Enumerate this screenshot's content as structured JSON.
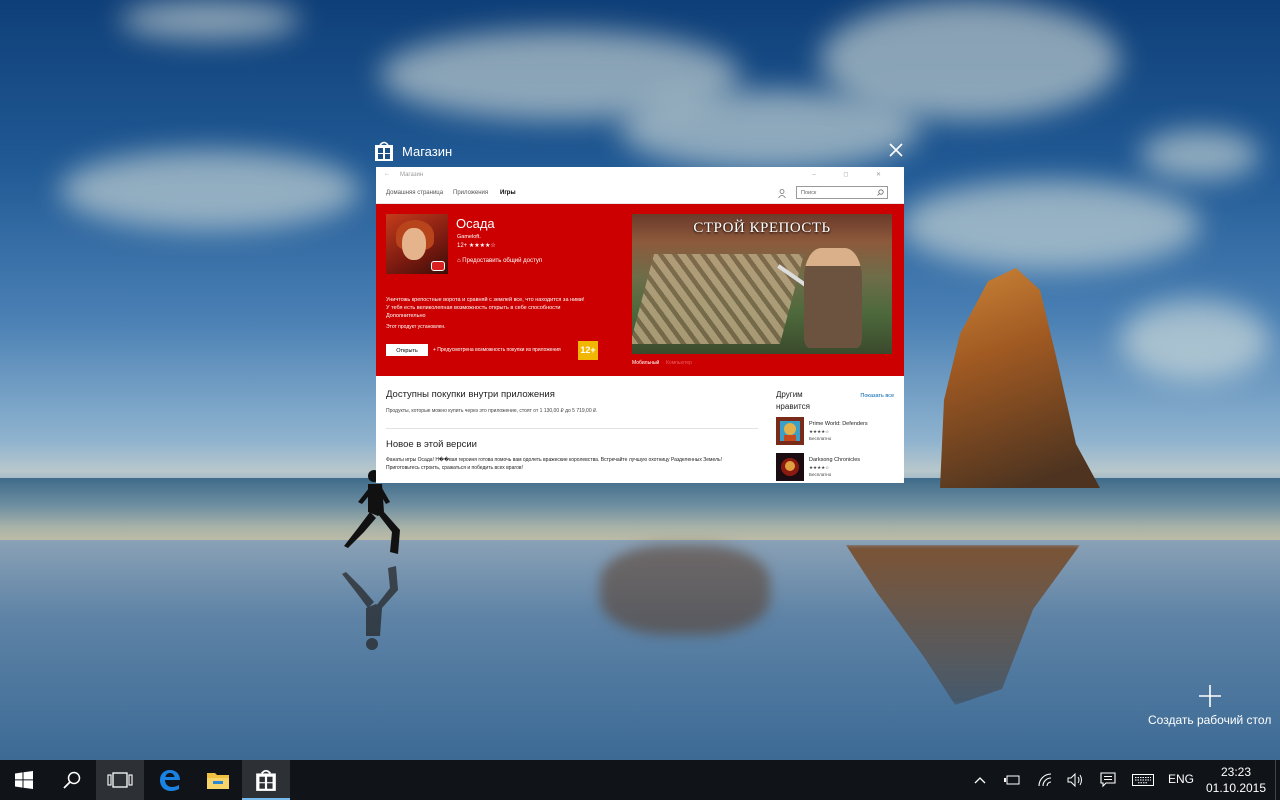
{
  "window": {
    "title": "Магазин"
  },
  "store": {
    "app_name": "Магазин",
    "titlebar_controls": "– ◻ ✕",
    "back_glyph": "←",
    "nav": {
      "home": "Домашняя страница",
      "apps": "Приложения",
      "games": "Игры",
      "search_placeholder": "Поиск"
    },
    "product": {
      "title": "Осада",
      "developer": "Gameloft.",
      "age": "12+",
      "rating_stars": "★★★★☆",
      "share": "Предоставить общий доступ",
      "description_lines": [
        "Уничтожь крепостные ворота и сравняй с землей все, что находится за ними!",
        "У тебя есть великолепная возможность открыть в себе способности",
        "Дополнительно"
      ],
      "installed": "Этот продукт установлен.",
      "open_button": "Открыть",
      "iap_note": "+ Предусмотрена возможность покупки из приложения",
      "pegi": "12+",
      "banner_text": "СТРОЙ КРЕПОСТЬ",
      "screenshot_tabs": [
        "Мобильный",
        "Компьютер"
      ]
    },
    "in_app": {
      "heading": "Доступны покупки внутри приложения",
      "text": "Продукты, которые можно купить через это приложение, стоят от 1 130,00 ₽ до 5 719,00 ₽."
    },
    "whats_new": {
      "heading": "Новое в этой версии",
      "lines": [
        "Фанаты игры Осада! Н��вая героиня готова помочь вам одолеть вражеские королевства. Встречайте лучшую охотницу Разделенных Земель!",
        "Приготовьтесь строить, сражаться и победить всех врагов!"
      ]
    },
    "sidebar": {
      "heading": "Другим нравится",
      "show_all": "Показать все",
      "items": [
        {
          "name": "Prime World: Defenders",
          "stars": "★★★★☆",
          "price": "Бесплатно"
        },
        {
          "name": "Darksong Chronicles",
          "stars": "★★★★☆",
          "price": "Бесплатно"
        }
      ]
    }
  },
  "new_desktop": {
    "label": "Создать рабочий стол"
  },
  "taskbar": {
    "language": "ENG",
    "time": "23:23",
    "date": "01.10.2015",
    "accent": "#76b9ed"
  }
}
